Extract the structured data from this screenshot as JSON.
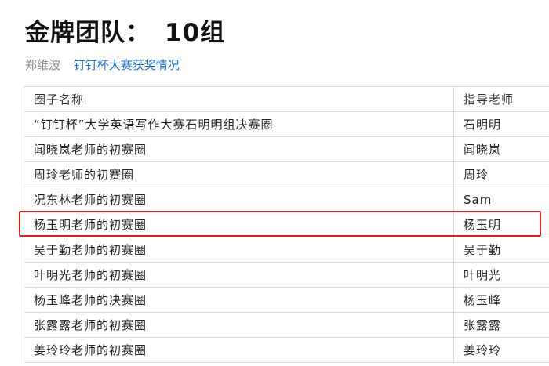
{
  "header": {
    "title_prefix": "金牌团队：",
    "title_value": "10组"
  },
  "meta": {
    "author": "郑维波",
    "link_text": "钉钉杯大赛获奖情况"
  },
  "table": {
    "headers": [
      "圈子名称",
      "指导老师"
    ],
    "rows": [
      [
        "“钉钉杯”大学英语写作大赛石明明组决赛圈",
        "石明明"
      ],
      [
        "闻晓岚老师的初赛圈",
        "闻晓岚"
      ],
      [
        "周玲老师的初赛圈",
        "周玲"
      ],
      [
        "况东林老师的初赛圈",
        "Sam"
      ],
      [
        "杨玉明老师的初赛圈",
        "杨玉明"
      ],
      [
        "吴于勤老师的初赛圈",
        "吴于勤"
      ],
      [
        "叶明光老师的初赛圈",
        "叶明光"
      ],
      [
        "杨玉峰老师的决赛圈",
        "杨玉峰"
      ],
      [
        "张露露老师的初赛圈",
        "张露露"
      ],
      [
        "姜玲玲老师的初赛圈",
        "姜玲玲"
      ]
    ],
    "highlighted_row": 4
  },
  "colors": {
    "link": "#1f6fd1",
    "highlight": "#e02020"
  }
}
